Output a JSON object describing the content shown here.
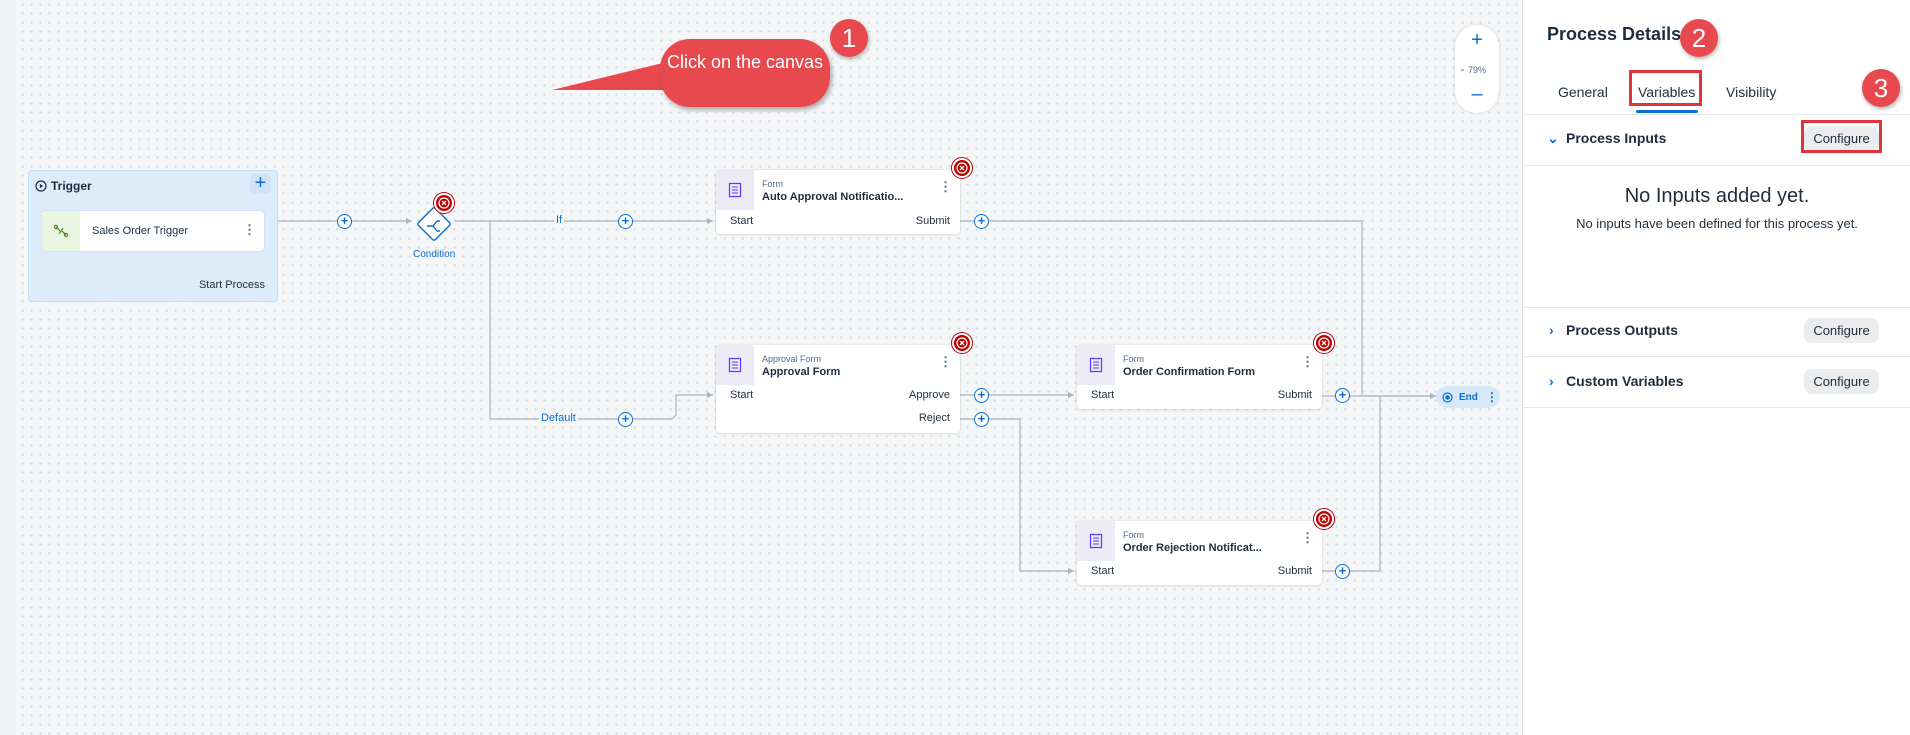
{
  "canvas": {
    "trigger": {
      "title": "Trigger",
      "card_label": "Sales Order Trigger",
      "footer": "Start Process"
    },
    "condition": {
      "label": "Condition"
    },
    "edge_labels": {
      "if": "If",
      "default": "Default"
    },
    "nodes": [
      {
        "type": "Form",
        "name": "Auto Approval Notificatio...",
        "ports": [
          "Start",
          "Submit"
        ],
        "has_error": true
      },
      {
        "type": "Approval Form",
        "name": "Approval Form",
        "ports": [
          "Start",
          "Approve",
          "Reject"
        ],
        "has_error": true
      },
      {
        "type": "Form",
        "name": "Order Confirmation Form",
        "ports": [
          "Start",
          "Submit"
        ],
        "has_error": true
      },
      {
        "type": "Form",
        "name": "Order Rejection Notificat...",
        "ports": [
          "Start",
          "Submit"
        ],
        "has_error": true
      }
    ],
    "end": {
      "label": "End"
    },
    "zoom": {
      "in": "+",
      "level": "79%",
      "out": "–"
    }
  },
  "annotations": {
    "callout_text": "Click on the canvas",
    "steps": [
      "1",
      "2",
      "3"
    ]
  },
  "panel": {
    "title": "Process Details",
    "tabs": [
      {
        "label": "General",
        "active": false
      },
      {
        "label": "Variables",
        "active": true
      },
      {
        "label": "Visibility",
        "active": false
      }
    ],
    "sections": [
      {
        "title": "Process Inputs",
        "expanded": true,
        "button": "Configure"
      },
      {
        "title": "Process Outputs",
        "expanded": false,
        "button": "Configure"
      },
      {
        "title": "Custom Variables",
        "expanded": false,
        "button": "Configure"
      }
    ],
    "empty_state": {
      "title": "No Inputs added yet.",
      "description": "No inputs have been defined for this process yet."
    }
  },
  "colors": {
    "accent": "#0a6ed1",
    "error": "#bb0000",
    "annotation": "#e8494f",
    "trigger_bg": "#dcecfb"
  }
}
